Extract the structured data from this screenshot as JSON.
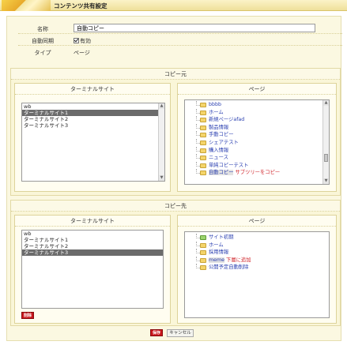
{
  "window": {
    "title": "コンテンツ共有設定"
  },
  "info": {
    "name_label": "名称",
    "name_value": "自動コピー",
    "sync_label": "自動同期",
    "sync_checkbox_label": "有効",
    "type_label": "タイプ",
    "type_value": "ページ"
  },
  "copy_src": {
    "section_title": "コピー元",
    "terminal_title": "ターミナルサイト",
    "terminal_items": [
      "wb",
      "ターミナルサイト1",
      "ターミナルサイト2",
      "ターミナルサイト3"
    ],
    "terminal_selected_index": 1,
    "page_title": "ページ",
    "tree_items": [
      {
        "label": "bbbb"
      },
      {
        "label": "ホーム"
      },
      {
        "label": "新規ページafad"
      },
      {
        "label": "製品情報"
      },
      {
        "label": "手動コピー"
      },
      {
        "label": "シェアテスト"
      },
      {
        "label": "購入情報"
      },
      {
        "label": "ニュース"
      },
      {
        "label": "単純コピーテスト"
      },
      {
        "label": "自動コピー",
        "note": "サブツリーをコピー",
        "highlight": true
      }
    ]
  },
  "copy_dst": {
    "section_title": "コピー先",
    "terminal_title": "ターミナルサイト",
    "terminal_items": [
      "wb",
      "ターミナルサイト1",
      "ターミナルサイト2",
      "ターミナルサイト3"
    ],
    "terminal_selected_index": 3,
    "delete_button": "削除",
    "page_title": "ページ",
    "tree_items": [
      {
        "label": "サイト初期",
        "green": true
      },
      {
        "label": "ホーム"
      },
      {
        "label": "採用情報"
      },
      {
        "label": "meme",
        "note": "下層に追加",
        "highlight": true
      },
      {
        "label": "公開予定自動削除"
      }
    ]
  },
  "footer": {
    "save_button": "保存",
    "cancel_button": "キャンセル"
  }
}
